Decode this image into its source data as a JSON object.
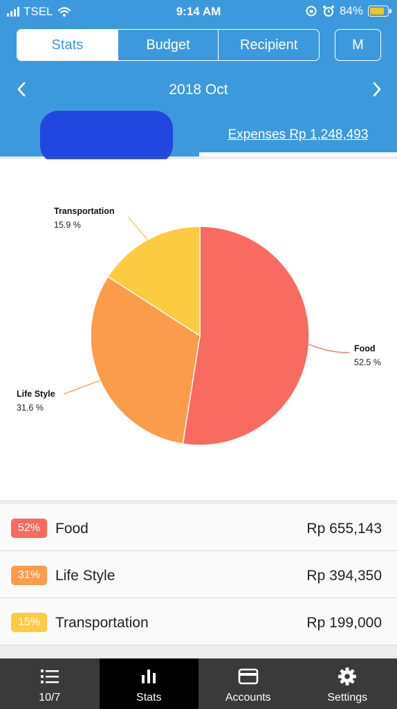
{
  "status_bar": {
    "carrier": "TSEL",
    "time": "9:14 AM",
    "battery": "84%",
    "battery_level": 0.84
  },
  "tabs": [
    {
      "label": "Stats",
      "active": true
    },
    {
      "label": "Budget",
      "active": false
    },
    {
      "label": "Recipient",
      "active": false
    }
  ],
  "m_button": "M",
  "month": "2018 Oct",
  "summary_tabs": {
    "expenses": "Expenses Rp 1,248,493"
  },
  "chart_data": {
    "type": "pie",
    "slices": [
      {
        "label": "Food",
        "value": 52.5,
        "display": "52.5 %",
        "color": "#f96a61"
      },
      {
        "label": "Life Style",
        "value": 31.6,
        "display": "31.6 %",
        "color": "#fb9c4d"
      },
      {
        "label": "Transportation",
        "value": 15.9,
        "display": "15.9 %",
        "color": "#fdcb42"
      }
    ]
  },
  "categories": [
    {
      "percent": "52%",
      "name": "Food",
      "amount": "Rp 655,143",
      "color": "#f96a61"
    },
    {
      "percent": "31%",
      "name": "Life Style",
      "amount": "Rp 394,350",
      "color": "#fb9c4d"
    },
    {
      "percent": "15%",
      "name": "Transportation",
      "amount": "Rp 199,000",
      "color": "#fdcb42"
    }
  ],
  "bottom_nav": [
    {
      "label": "10/7",
      "icon": "list-icon",
      "active": false
    },
    {
      "label": "Stats",
      "icon": "bar-chart-icon",
      "active": true
    },
    {
      "label": "Accounts",
      "icon": "card-icon",
      "active": false
    },
    {
      "label": "Settings",
      "icon": "gear-icon",
      "active": false
    }
  ]
}
